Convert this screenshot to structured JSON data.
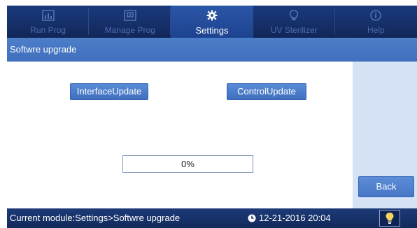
{
  "colors": {
    "nav_bg": "#16306a",
    "active_tab": "#2a56a6",
    "subheader": "#4677c6",
    "button": "#4a7bc8",
    "right_panel": "#d6e3f6",
    "status_bar": "#152e62",
    "bulb": "#f4d35e"
  },
  "nav": {
    "tabs": [
      {
        "label": "Run Prog",
        "icon": "chart-icon",
        "active": false
      },
      {
        "label": "Manage Prog",
        "icon": "folder-icon",
        "active": false
      },
      {
        "label": "Settings",
        "icon": "gear-icon",
        "active": true
      },
      {
        "label": "UV Sterilizer",
        "icon": "bulb-icon",
        "active": false
      },
      {
        "label": "Help",
        "icon": "info-icon",
        "active": false
      }
    ]
  },
  "header": {
    "title": "Softwre upgrade"
  },
  "main": {
    "interface_update_label": "InterfaceUpdate",
    "control_update_label": "ControlUpdate",
    "progress": {
      "value": 0,
      "label": "0%"
    }
  },
  "right_panel": {
    "back_label": "Back"
  },
  "status": {
    "module": "Current module:Settings>Softwre upgrade",
    "datetime": "12-21-2016 20:04",
    "clock_icon": "clock-icon",
    "light_icon": "lightbulb-icon"
  }
}
